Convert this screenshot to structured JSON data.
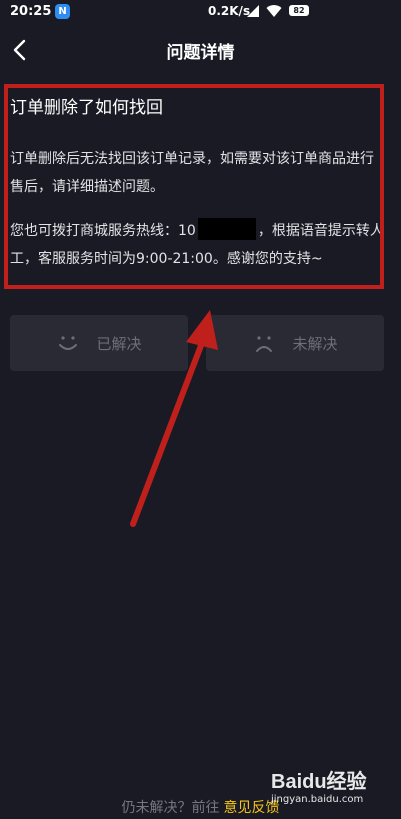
{
  "status_bar": {
    "time": "20:25",
    "app_badge": "N",
    "network_speed": "0.2K/s",
    "battery": "82",
    "icons": [
      "app-notification-icon",
      "sim-signal-icon",
      "wifi-icon",
      "battery-icon"
    ]
  },
  "nav": {
    "title": "问题详情",
    "back_icon": "chevron-left-icon"
  },
  "article": {
    "title": "订单删除了如何找回",
    "paragraph1": "订单删除后无法找回该订单记录，如需要对该订单商品进行售后，请详细描述问题。",
    "paragraph2_before": "您也可拨打商城服务热线：10",
    "paragraph2_after": "，根据语音提示转人工，客服服务时间为9:00-21:00。感谢您的支持~"
  },
  "feedback": {
    "solved_label": "已解决",
    "unsolved_label": "未解决",
    "solved_icon": "smile-face-icon",
    "unsolved_icon": "sad-face-icon"
  },
  "footer": {
    "prompt": "仍未解决？前往",
    "link_label": "意见反馈"
  },
  "watermark": {
    "logo": "Baidu经验",
    "url": "jingyan.baidu.com"
  },
  "colors": {
    "background": "#1a1a24",
    "button_bg": "#2a2a34",
    "annotation_red": "#c0201c",
    "link_yellow": "#f5c518"
  }
}
